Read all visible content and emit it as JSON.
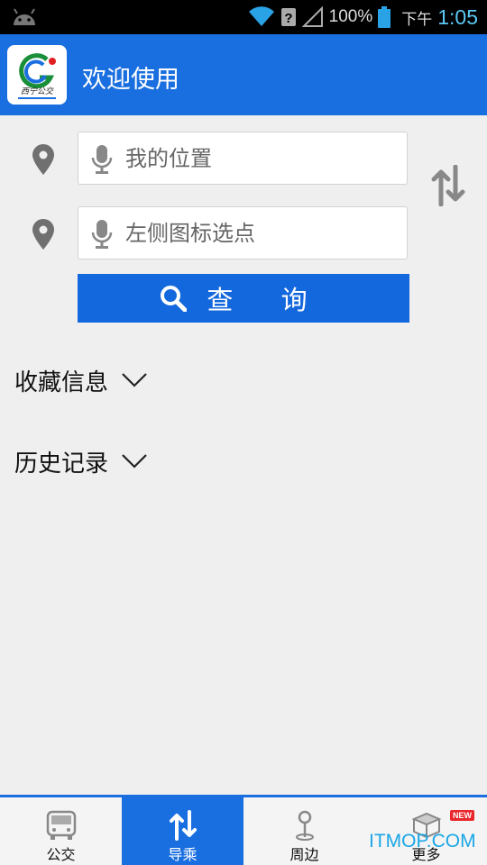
{
  "status_bar": {
    "battery": "100%",
    "time_label": "下午",
    "time": "1:05"
  },
  "header": {
    "title": "欢迎使用",
    "logo_text": "西宁公交"
  },
  "search": {
    "start_placeholder": "我的位置",
    "end_placeholder": "左侧图标选点",
    "query_label": "查 询"
  },
  "sections": {
    "favorites": "收藏信息",
    "history": "历史记录"
  },
  "nav": {
    "items": [
      {
        "label": "公交",
        "icon": "bus-icon"
      },
      {
        "label": "导乘",
        "icon": "route-icon"
      },
      {
        "label": "周边",
        "icon": "nearby-pin-icon"
      },
      {
        "label": "更多",
        "icon": "more-box-icon"
      }
    ],
    "new_badge": "NEW"
  },
  "watermark": "ITMOP.COM",
  "colors": {
    "primary": "#1a6fe0",
    "button": "#1468dd",
    "background": "#efefef"
  }
}
